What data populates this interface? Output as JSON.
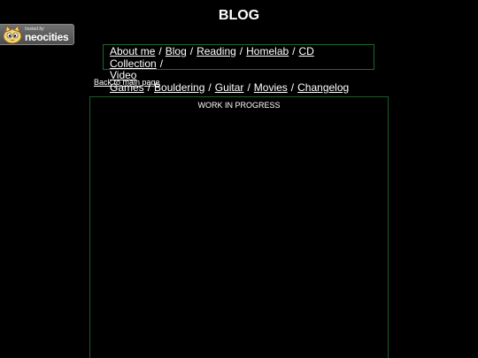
{
  "badge": {
    "icon": "neocities-cat-icon",
    "small_text": "hosted by",
    "big_text": "neocities"
  },
  "page": {
    "title": "BLOG"
  },
  "nav": {
    "items": [
      {
        "label": "About me"
      },
      {
        "label": "Blog"
      },
      {
        "label": "Reading"
      },
      {
        "label": "Homelab"
      },
      {
        "label": "CD Collection"
      },
      {
        "label": "Video Games"
      },
      {
        "label": "Bouldering"
      },
      {
        "label": "Guitar"
      },
      {
        "label": "Movies"
      },
      {
        "label": "Changelog"
      }
    ],
    "separator": "/"
  },
  "back_link": "Back to main page",
  "content": {
    "status": "WORK IN PROGRESS"
  },
  "colors": {
    "background": "#000000",
    "text": "#ffffff",
    "border": "#1c6a2c"
  }
}
